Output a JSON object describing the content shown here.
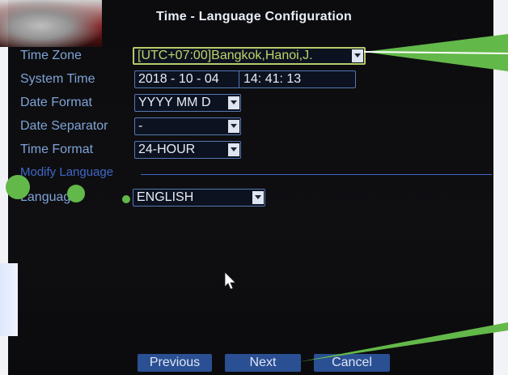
{
  "dialog": {
    "title": "Time - Language Configuration"
  },
  "fields": {
    "time_zone": {
      "label": "Time Zone",
      "value": "[UTC+07:00]Bangkok,Hanoi,J."
    },
    "system_time": {
      "label": "System Time",
      "date": "2018 - 10 - 04",
      "time": "14: 41: 13"
    },
    "date_format": {
      "label": "Date Format",
      "value": "YYYY MM D"
    },
    "date_separator": {
      "label": "Date Separator",
      "value": "-"
    },
    "time_format": {
      "label": "Time Format",
      "value": "24-HOUR"
    }
  },
  "language_section": {
    "title": "Modify Language",
    "label": "Language",
    "value": "ENGLISH"
  },
  "buttons": {
    "previous": "Previous",
    "next": "Next",
    "cancel": "Cancel"
  },
  "colors": {
    "accent": "#3f67c7",
    "label": "#7fa3d6",
    "selected_field": "#bed469",
    "annotation": "#63b84a"
  }
}
